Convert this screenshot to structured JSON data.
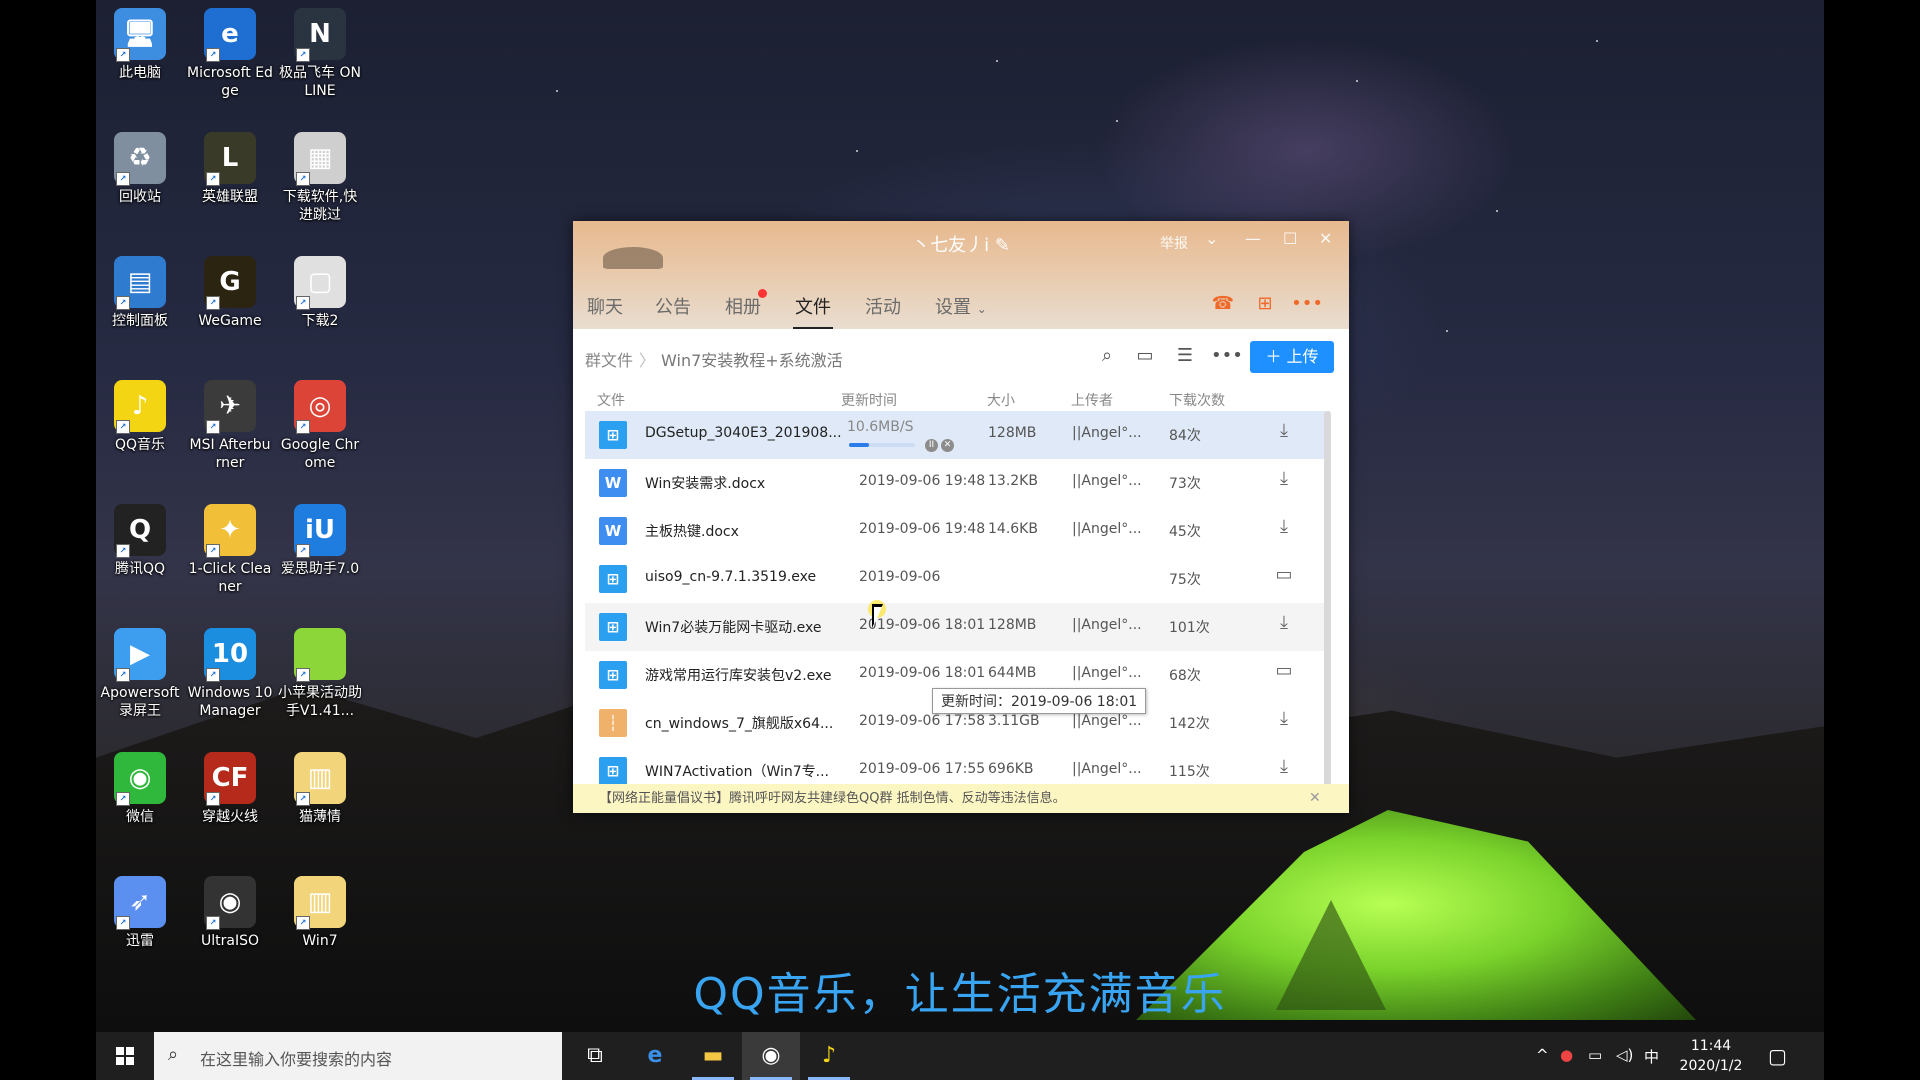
{
  "desktop_icons": [
    {
      "name": "此电脑",
      "color": "#3d8ee0",
      "glyph": "🖥"
    },
    {
      "name": "Microsoft Edge",
      "color": "#1e6fd1",
      "glyph": "e"
    },
    {
      "name": "极品飞车 ONLINE",
      "color": "#2a3340",
      "glyph": "N"
    },
    {
      "name": "回收站",
      "color": "#7f8fa0",
      "glyph": "♻"
    },
    {
      "name": "英雄联盟",
      "color": "#3a3a28",
      "glyph": "L"
    },
    {
      "name": "下载软件,快进跳过",
      "color": "#cfcfcf",
      "glyph": "▦"
    },
    {
      "name": "控制面板",
      "color": "#2f7bd0",
      "glyph": "▤"
    },
    {
      "name": "WeGame",
      "color": "#2a2410",
      "glyph": "G"
    },
    {
      "name": "下载2",
      "color": "#e0e0e0",
      "glyph": "▢"
    },
    {
      "name": "QQ音乐",
      "color": "#f3d514",
      "glyph": "♪"
    },
    {
      "name": "MSI Afterburner",
      "color": "#3b3b3b",
      "glyph": "✈"
    },
    {
      "name": "Google Chrome",
      "color": "#db4437",
      "glyph": "◎"
    },
    {
      "name": "腾讯QQ",
      "color": "#222222",
      "glyph": "Q"
    },
    {
      "name": "1-Click Cleaner",
      "color": "#f2c038",
      "glyph": "✦"
    },
    {
      "name": "爱思助手7.0",
      "color": "#1f7de0",
      "glyph": "iU"
    },
    {
      "name": "Apowersoft 录屏王",
      "color": "#3d9ef0",
      "glyph": "▶"
    },
    {
      "name": "Windows 10 Manager",
      "color": "#1c8ee0",
      "glyph": "10"
    },
    {
      "name": "小苹果活动助手V1.41...",
      "color": "#8dd63a",
      "glyph": ""
    },
    {
      "name": "微信",
      "color": "#2fb83b",
      "glyph": "◉"
    },
    {
      "name": "穿越火线",
      "color": "#b52a1a",
      "glyph": "CF"
    },
    {
      "name": "猫薄情",
      "color": "#f2d47a",
      "glyph": "▥"
    },
    {
      "name": "迅雷",
      "color": "#5b8ff0",
      "glyph": "➶"
    },
    {
      "name": "UltraISO",
      "color": "#333333",
      "glyph": "◉"
    },
    {
      "name": "Win7",
      "color": "#f2d47a",
      "glyph": "▥"
    }
  ],
  "qq_window": {
    "title": "丶七友丿i ✎",
    "report": "举报",
    "tabs": [
      "聊天",
      "公告",
      "相册",
      "文件",
      "活动",
      "设置"
    ],
    "active_tab": "文件",
    "breadcrumb": {
      "root": "群文件",
      "current": "Win7安装教程+系统激活"
    },
    "upload_label": "上传",
    "columns": [
      "文件",
      "更新时间",
      "大小",
      "上传者",
      "下载次数"
    ],
    "downloading": {
      "speed": "10.6MB/S",
      "progress": 0.3
    },
    "files": [
      {
        "name": "DGSetup_3040E3_201908...",
        "type": "exe",
        "date": "",
        "size": "128MB",
        "uploader": "||Angel°...",
        "count": "84次",
        "action": "download"
      },
      {
        "name": "Win安装需求.docx",
        "type": "doc",
        "date": "2019-09-06 19:48",
        "size": "13.2KB",
        "uploader": "||Angel°...",
        "count": "73次",
        "action": "download"
      },
      {
        "name": "主板热键.docx",
        "type": "doc",
        "date": "2019-09-06 19:48",
        "size": "14.6KB",
        "uploader": "||Angel°...",
        "count": "45次",
        "action": "download"
      },
      {
        "name": "uiso9_cn-9.7.1.3519.exe",
        "type": "exe",
        "date": "2019-09-06",
        "size": "",
        "uploader": "",
        "count": "75次",
        "action": "folder"
      },
      {
        "name": "Win7必装万能网卡驱动.exe",
        "type": "exe",
        "date": "2019-09-06 18:01",
        "size": "128MB",
        "uploader": "||Angel°...",
        "count": "101次",
        "action": "download"
      },
      {
        "name": "游戏常用运行库安装包v2.exe",
        "type": "exe",
        "date": "2019-09-06 18:01",
        "size": "644MB",
        "uploader": "||Angel°...",
        "count": "68次",
        "action": "folder"
      },
      {
        "name": "cn_windows_7_旗舰版x64...",
        "type": "zip",
        "date": "2019-09-06 17:58",
        "size": "3.11GB",
        "uploader": "||Angel°...",
        "count": "142次",
        "action": "download"
      },
      {
        "name": "WIN7Activation（Win7专...",
        "type": "exe",
        "date": "2019-09-06 17:55",
        "size": "696KB",
        "uploader": "||Angel°...",
        "count": "115次",
        "action": "download"
      }
    ],
    "tooltip": "更新时间：2019-09-06 18:01",
    "notice": "【网络正能量倡议书】腾讯呼吁网友共建绿色QQ群 抵制色情、反动等违法信息。"
  },
  "subtitle": "QQ音乐，让生活充满音乐",
  "taskbar": {
    "search_placeholder": "在这里输入你要搜索的内容",
    "ime": "中",
    "time": "11:44",
    "date": "2020/1/2"
  }
}
